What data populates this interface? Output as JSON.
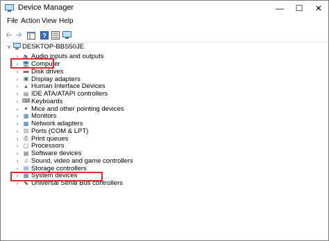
{
  "window": {
    "title": "Device Manager"
  },
  "menu": [
    "File",
    "Action",
    "View",
    "Help"
  ],
  "tree": {
    "root": "DESKTOP-BBS50JE",
    "items": [
      {
        "label": "Audio inputs and outputs",
        "icon": "speaker-icon"
      },
      {
        "label": "Computer",
        "icon": "computer-icon"
      },
      {
        "label": "Disk drives",
        "icon": "disk-drive-icon",
        "highlighted": true
      },
      {
        "label": "Display adapters",
        "icon": "display-adapter-icon"
      },
      {
        "label": "Human Interface Devices",
        "icon": "hid-icon"
      },
      {
        "label": "IDE ATA/ATAPI controllers",
        "icon": "ide-controller-icon"
      },
      {
        "label": "Keyboards",
        "icon": "keyboard-icon"
      },
      {
        "label": "Mice and other pointing devices",
        "icon": "mouse-icon"
      },
      {
        "label": "Monitors",
        "icon": "monitor-icon"
      },
      {
        "label": "Network adapters",
        "icon": "network-adapter-icon"
      },
      {
        "label": "Ports (COM & LPT)",
        "icon": "port-icon"
      },
      {
        "label": "Print queues",
        "icon": "printer-icon"
      },
      {
        "label": "Processors",
        "icon": "processor-icon"
      },
      {
        "label": "Software devices",
        "icon": "software-device-icon"
      },
      {
        "label": "Sound, video and game controllers",
        "icon": "sound-controller-icon"
      },
      {
        "label": "Storage controllers",
        "icon": "storage-controller-icon"
      },
      {
        "label": "System devices",
        "icon": "system-device-icon"
      },
      {
        "label": "Universal Serial Bus controllers",
        "icon": "usb-icon",
        "highlighted": true
      }
    ]
  },
  "colors": {
    "highlight": "#e0282a"
  }
}
